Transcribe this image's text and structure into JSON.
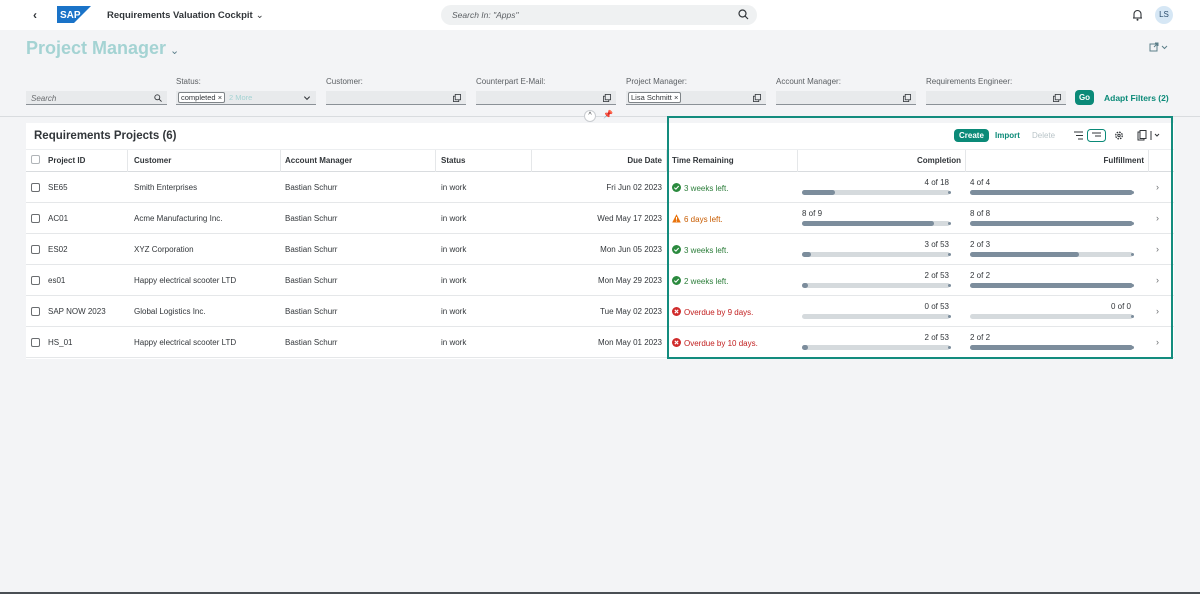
{
  "shell": {
    "back_label": "‹",
    "brand": "SAP",
    "app_title": "Requirements Valuation Cockpit",
    "search_placeholder": "Search In: \"Apps\"",
    "avatar_initials": "LS"
  },
  "header": {
    "title": "Project Manager"
  },
  "filters": {
    "search_placeholder": "Search",
    "status_label": "Status:",
    "status_token": "completed",
    "status_more": "2 More",
    "customer_label": "Customer:",
    "counterpart_label": "Counterpart E-Mail:",
    "pm_label": "Project Manager:",
    "pm_token": "Lisa Schmitt",
    "am_label": "Account Manager:",
    "re_label": "Requirements Engineer:",
    "go_label": "Go",
    "adapt_label": "Adapt Filters (2)"
  },
  "table": {
    "title": "Requirements Projects (6)",
    "create_label": "Create",
    "import_label": "Import",
    "delete_label": "Delete",
    "columns": {
      "project_id": "Project ID",
      "customer": "Customer",
      "account_manager": "Account Manager",
      "status": "Status",
      "due_date": "Due Date",
      "time_remaining": "Time Remaining",
      "completion": "Completion",
      "fulfillment": "Fulfillment"
    },
    "rows": [
      {
        "id": "SE65",
        "customer": "Smith Enterprises",
        "am": "Bastian Schurr",
        "status": "in work",
        "due": "Fri Jun 02 2023",
        "remaining": "3 weeks left.",
        "state": "ok",
        "completion_label": "4 of 18",
        "completion": 0.22,
        "fulfillment_label": "4 of 4",
        "fulfillment": 1.0
      },
      {
        "id": "AC01",
        "customer": "Acme Manufacturing Inc.",
        "am": "Bastian Schurr",
        "status": "in work",
        "due": "Wed May 17 2023",
        "remaining": "6 days left.",
        "state": "warn",
        "completion_label": "8 of 9",
        "completion": 0.89,
        "fulfillment_label": "8 of 8",
        "fulfillment": 1.0
      },
      {
        "id": "ES02",
        "customer": "XYZ Corporation",
        "am": "Bastian Schurr",
        "status": "in work",
        "due": "Mon Jun 05 2023",
        "remaining": "3 weeks left.",
        "state": "ok",
        "completion_label": "3 of 53",
        "completion": 0.06,
        "fulfillment_label": "2 of 3",
        "fulfillment": 0.67
      },
      {
        "id": "es01",
        "customer": "Happy electrical scooter LTD",
        "am": "Bastian Schurr",
        "status": "in work",
        "due": "Mon May 29 2023",
        "remaining": "2 weeks left.",
        "state": "ok",
        "completion_label": "2 of 53",
        "completion": 0.04,
        "fulfillment_label": "2 of 2",
        "fulfillment": 1.0
      },
      {
        "id": "SAP NOW 2023",
        "customer": "Global Logistics Inc.",
        "am": "Bastian Schurr",
        "status": "in work",
        "due": "Tue May 02 2023",
        "remaining": "Overdue by 9 days.",
        "state": "err",
        "completion_label": "0 of 53",
        "completion": 0.0,
        "fulfillment_label": "0 of 0",
        "fulfillment": 0.0
      },
      {
        "id": "HS_01",
        "customer": "Happy electrical scooter LTD",
        "am": "Bastian Schurr",
        "status": "in work",
        "due": "Mon May 01 2023",
        "remaining": "Overdue by 10 days.",
        "state": "err",
        "completion_label": "2 of 53",
        "completion": 0.04,
        "fulfillment_label": "2 of 2",
        "fulfillment": 1.0
      }
    ]
  },
  "colors": {
    "accent": "#0b8a78",
    "title_color": "#a4d3d3",
    "ok": "#2b8a3e",
    "warn": "#e9730c",
    "err": "#d02b2b",
    "bar_fill": "#7c8d9c",
    "highlight": "#138c7e"
  },
  "icons": {
    "back": "back-chevron-icon",
    "search": "search-icon",
    "bell": "bell-icon",
    "share": "share-icon",
    "value_help": "value-help-icon",
    "ok": "check-circle-icon",
    "warn": "warning-triangle-icon",
    "err": "error-circle-icon",
    "nav": "chevron-right-icon"
  }
}
